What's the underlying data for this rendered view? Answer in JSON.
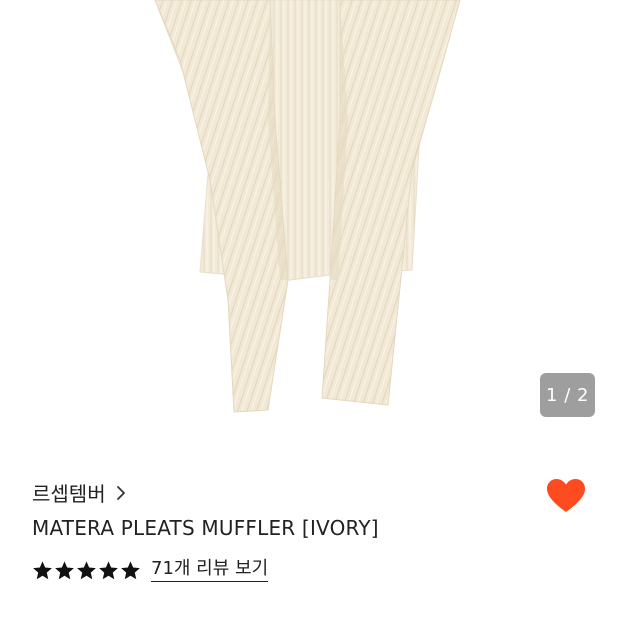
{
  "gallery": {
    "counter": "1 / 2",
    "image_alt": "ivory pleated muffler product photo"
  },
  "product": {
    "brand": "르셉템버",
    "title": "MATERA PLEATS MUFFLER [IVORY]",
    "rating": 5,
    "review_link": "71개 리뷰 보기",
    "price_text": "—"
  },
  "colors": {
    "heart": "#FF4B1F",
    "counter_bg": "#9E9E9E",
    "fabric": "#F3EBDA"
  },
  "icons": {
    "brand_chevron": "chevron-right-icon",
    "wishlist": "heart-icon",
    "star": "star-icon"
  }
}
